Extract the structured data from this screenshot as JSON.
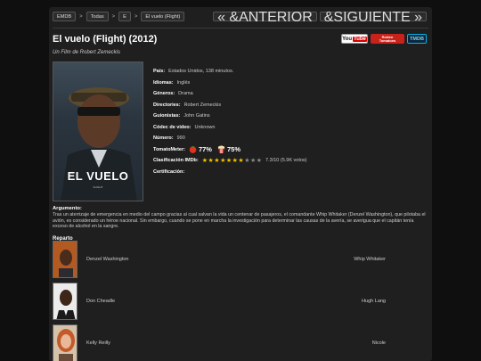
{
  "nav": {
    "breadcrumbs": [
      "EMDB",
      "Todas",
      "E",
      "El vuelo (Flight)"
    ],
    "separator": ">",
    "prev_label": "« &ANTERIOR",
    "next_label": "&SIGUIENTE »"
  },
  "movie": {
    "title": "El vuelo (Flight) (2012)",
    "subtitle": "Un Film de Robert Zemeckis",
    "poster_title": "EL VUELO",
    "poster_subtitle": "FLIGHT"
  },
  "badges": {
    "youtube_you": "You",
    "youtube_tube": "Tube",
    "rt_line1": "Rotten",
    "rt_line2": "Tomatoes",
    "tmdb": "TMDB"
  },
  "details": {
    "pais": {
      "label": "País:",
      "value": "Estados Unidos, 138 minutos."
    },
    "idiomas": {
      "label": "Idiomas:",
      "value": "Inglés"
    },
    "generos": {
      "label": "Géneros:",
      "value": "Drama"
    },
    "directores": {
      "label": "Directories:",
      "value": "Robert Zemeckis"
    },
    "guionistas": {
      "label": "Guionistas:",
      "value": "John Gatins"
    },
    "codec": {
      "label": "Códec de video:",
      "value": "Unknown"
    },
    "numero": {
      "label": "Número:",
      "value": "990"
    },
    "tomatometer": {
      "label": "TomatoMeter:",
      "critics": "77%",
      "audience": "75%"
    },
    "imdb": {
      "label": "Clasificación IMDb:",
      "value": "7.3/10 (5.9K votos)",
      "rating": 7.3,
      "max": 10
    },
    "certificacion": {
      "label": "Certificación:",
      "value": ""
    }
  },
  "argumento": {
    "label": "Argumento:",
    "text": "Tras un aterrizaje de emergencia en medio del campo gracias al cual salvan la vida un centenar de pasajeros, el comandante Whip Whitaker (Denzel Washington), que pilotaba el avión, es considerado un héroe nacional. Sin embargo, cuando se pone en marcha la investigación para determinar las causas de la avería, se averigua que el capitán tenía exceso de alcohol en la sangre."
  },
  "reparto": {
    "label": "Reparto",
    "cast": [
      {
        "actor": "Denzel Washington",
        "role": "Whip Whitaker"
      },
      {
        "actor": "Don Cheadle",
        "role": "Hugh Lang"
      },
      {
        "actor": "Kelly Reilly",
        "role": "Nicole"
      }
    ]
  },
  "colors": {
    "background": "#0f0f0f",
    "panel": "#1f1f1f",
    "star_on": "#f2c200",
    "star_off": "#888888"
  }
}
